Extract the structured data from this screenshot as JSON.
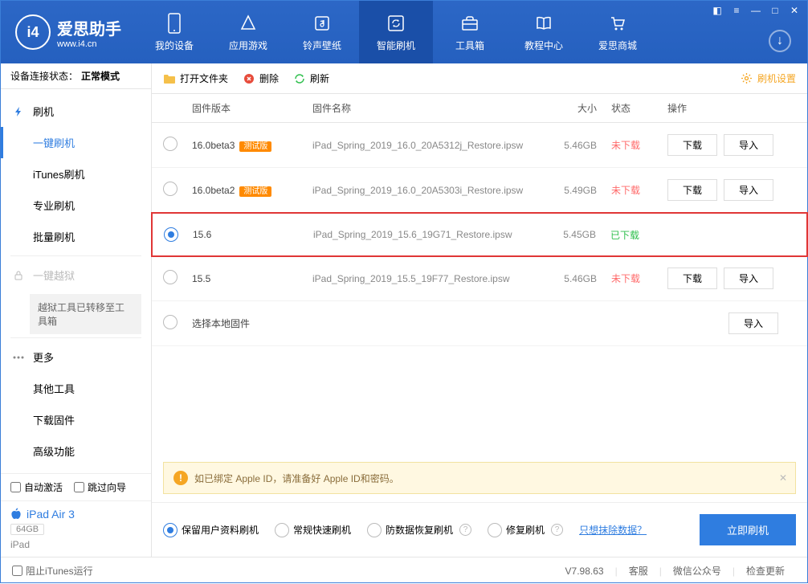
{
  "app": {
    "name": "爱思助手",
    "site": "www.i4.cn"
  },
  "nav": [
    {
      "label": "我的设备"
    },
    {
      "label": "应用游戏"
    },
    {
      "label": "铃声壁纸"
    },
    {
      "label": "智能刷机"
    },
    {
      "label": "工具箱"
    },
    {
      "label": "教程中心"
    },
    {
      "label": "爱思商城"
    }
  ],
  "status": {
    "label": "设备连接状态：",
    "value": "正常模式"
  },
  "sidebar": {
    "flash": "刷机",
    "items": [
      "一键刷机",
      "iTunes刷机",
      "专业刷机",
      "批量刷机"
    ],
    "jailbreak": "一键越狱",
    "jb_note": "越狱工具已转移至工具箱",
    "more": "更多",
    "more_items": [
      "其他工具",
      "下载固件",
      "高级功能"
    ],
    "auto_activate": "自动激活",
    "skip_wizard": "跳过向导"
  },
  "device": {
    "name": "iPad Air 3",
    "capacity": "64GB",
    "type": "iPad"
  },
  "toolbar": {
    "open": "打开文件夹",
    "delete": "删除",
    "refresh": "刷新",
    "settings": "刷机设置"
  },
  "table": {
    "headers": {
      "version": "固件版本",
      "name": "固件名称",
      "size": "大小",
      "status": "状态",
      "ops": "操作"
    },
    "ops": {
      "download": "下载",
      "import": "导入"
    },
    "rows": [
      {
        "ver": "16.0beta3",
        "beta": "测试版",
        "name": "iPad_Spring_2019_16.0_20A5312j_Restore.ipsw",
        "size": "5.46GB",
        "status": "未下载",
        "selected": false,
        "downloadable": true
      },
      {
        "ver": "16.0beta2",
        "beta": "测试版",
        "name": "iPad_Spring_2019_16.0_20A5303i_Restore.ipsw",
        "size": "5.49GB",
        "status": "未下载",
        "selected": false,
        "downloadable": true
      },
      {
        "ver": "15.6",
        "beta": "",
        "name": "iPad_Spring_2019_15.6_19G71_Restore.ipsw",
        "size": "5.45GB",
        "status": "已下载",
        "selected": true,
        "downloadable": false
      },
      {
        "ver": "15.5",
        "beta": "",
        "name": "iPad_Spring_2019_15.5_19F77_Restore.ipsw",
        "size": "5.46GB",
        "status": "未下载",
        "selected": false,
        "downloadable": true
      }
    ],
    "local": "选择本地固件"
  },
  "warning": "如已绑定 Apple ID，请准备好 Apple ID和密码。",
  "options": {
    "o1": "保留用户资料刷机",
    "o2": "常规快速刷机",
    "o3": "防数据恢复刷机",
    "o4": "修复刷机",
    "erase_link": "只想抹除数据？",
    "action": "立即刷机"
  },
  "footer": {
    "block": "阻止iTunes运行",
    "version": "V7.98.63",
    "service": "客服",
    "wechat": "微信公众号",
    "update": "检查更新"
  }
}
